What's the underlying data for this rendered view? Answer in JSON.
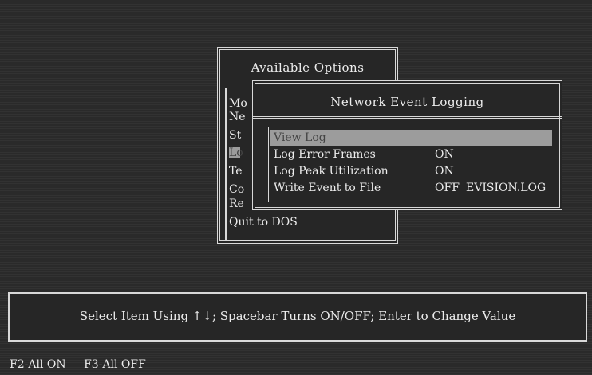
{
  "options_menu": {
    "title": "Available Options",
    "items": [
      "Mo",
      "Ne",
      "St",
      "Lo",
      "Te",
      "Co",
      "Re"
    ],
    "quit": "Quit to DOS"
  },
  "logging_dialog": {
    "title": "Network Event Logging",
    "rows": [
      {
        "label": "View Log",
        "value": "",
        "file": ""
      },
      {
        "label": "Log Error Frames",
        "value": "ON",
        "file": ""
      },
      {
        "label": "Log Peak Utilization",
        "value": "ON",
        "file": ""
      },
      {
        "label": "Write Event to File",
        "value": "OFF",
        "file": "EVISION.LOG"
      }
    ]
  },
  "status_bar": {
    "message": "Select Item Using ↑↓; Spacebar Turns ON/OFF; Enter to Change Value"
  },
  "function_keys": {
    "f2": "F2-All ON",
    "f3": "F3-All OFF"
  }
}
